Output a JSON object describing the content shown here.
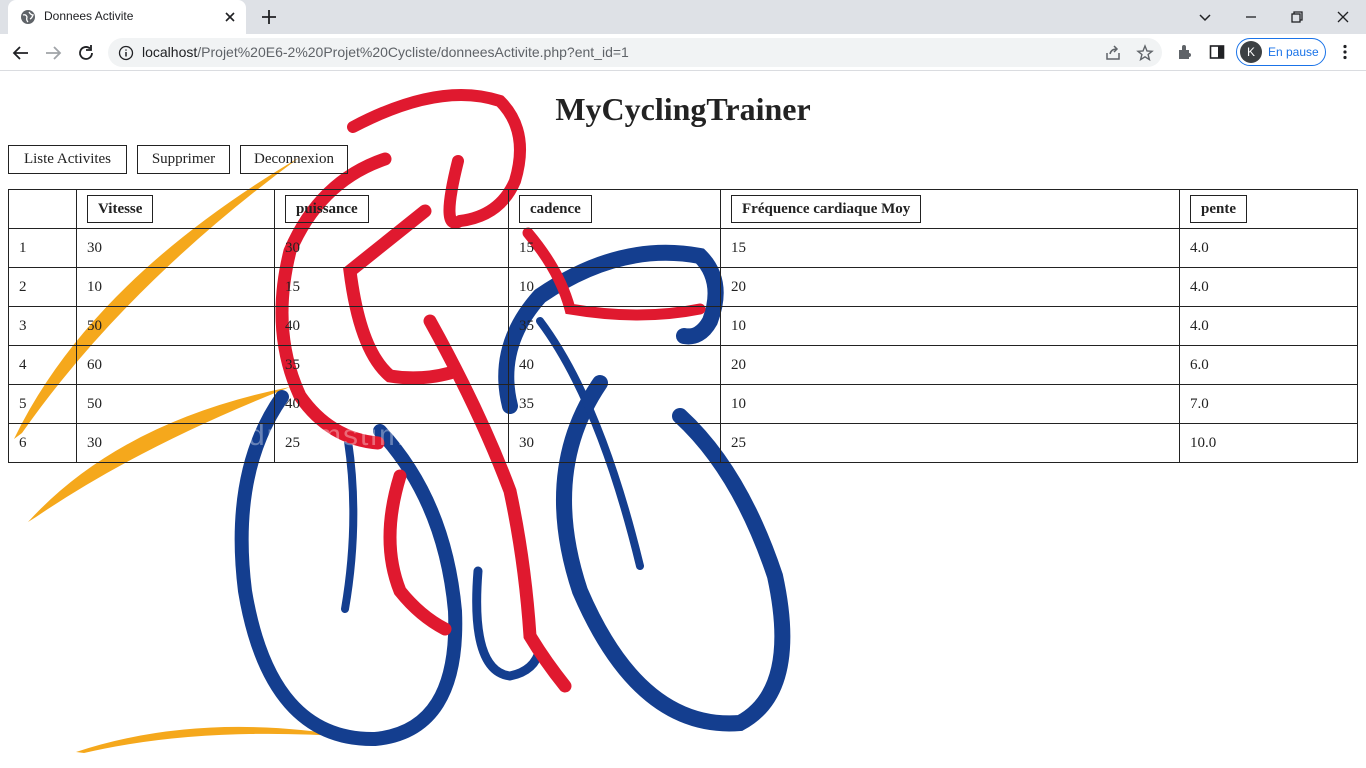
{
  "browser": {
    "tab_title": "Donnees Activite",
    "url_host": "localhost",
    "url_path": "/Projet%20E6-2%20Projet%20Cycliste/donneesActivite.php?ent_id=1",
    "profile_initial": "K",
    "profile_status": "En pause",
    "colors": {
      "tabstrip": "#dee1e6",
      "accent": "#1a73e8"
    }
  },
  "page": {
    "title": "MyCyclingTrainer",
    "buttons": {
      "list": "Liste Activites",
      "delete": "Supprimer",
      "logout": "Deconnexion"
    },
    "table": {
      "headers": [
        "",
        "Vitesse",
        "puissance",
        "cadence",
        "Fréquence cardiaque Moy",
        "pente"
      ],
      "rows": [
        [
          "1",
          "30",
          "30",
          "15",
          "15",
          "4.0"
        ],
        [
          "2",
          "10",
          "15",
          "10",
          "20",
          "4.0"
        ],
        [
          "3",
          "50",
          "40",
          "35",
          "10",
          "4.0"
        ],
        [
          "4",
          "60",
          "35",
          "40",
          "20",
          "6.0"
        ],
        [
          "5",
          "50",
          "40",
          "35",
          "10",
          "7.0"
        ],
        [
          "6",
          "30",
          "25",
          "30",
          "25",
          "10.0"
        ]
      ]
    },
    "background_colors": {
      "rider": "#e0192f",
      "bike": "#143e8f",
      "swoosh": "#f5a81c"
    }
  }
}
